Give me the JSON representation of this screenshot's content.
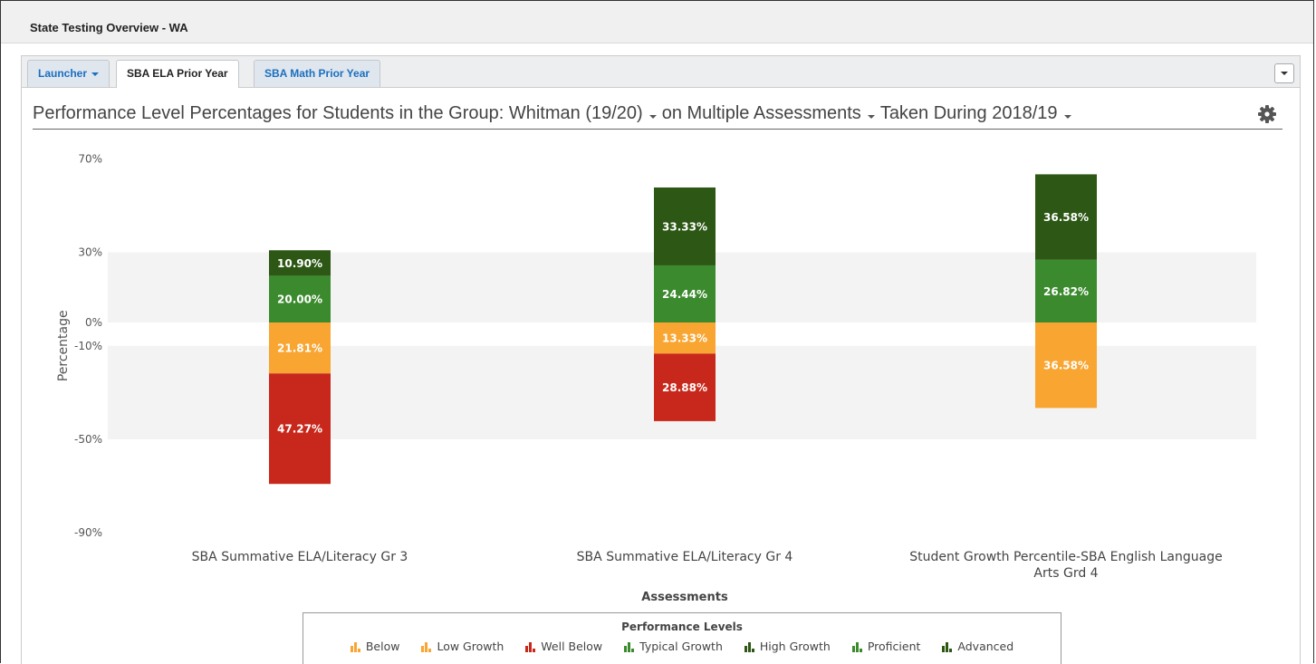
{
  "window": {
    "title": "State Testing Overview - WA"
  },
  "tabs": [
    {
      "label": "Launcher",
      "dropdown": true,
      "active": false
    },
    {
      "label": "SBA ELA Prior Year",
      "active": true
    },
    {
      "label": "SBA Math Prior Year",
      "active": false
    }
  ],
  "headline": {
    "prefix": "Performance Level Percentages for Students in the Group:",
    "group": "Whitman (19/20)",
    "on_word": "on",
    "assessment": "Multiple Assessments",
    "taken_word": "Taken During",
    "year": "2018/19"
  },
  "colors": {
    "advanced": "#2c5714",
    "proficient": "#3c8a2e",
    "below": "#f9a531",
    "well_below": "#c8281c",
    "band": "#f3f3f3"
  },
  "chart_data": {
    "type": "bar",
    "stacked": "diverging",
    "ylabel": "Percentage",
    "xlabel": "Assessments",
    "ylim": [
      -90,
      70
    ],
    "y_ticks": [
      "70%",
      "30%",
      "0%",
      "-10%",
      "-50%",
      "-90%"
    ],
    "categories": [
      "SBA Summative ELA/Literacy Gr 3",
      "SBA Summative ELA/Literacy Gr 4",
      "Student Growth Percentile-SBA English Language Arts Grd 4"
    ],
    "category_lines": [
      [
        "SBA Summative ELA/Literacy Gr 3"
      ],
      [
        "SBA Summative ELA/Literacy Gr 4"
      ],
      [
        "Student Growth Percentile-SBA English Language",
        "Arts Grd 4"
      ]
    ],
    "bars": [
      {
        "segments": [
          {
            "level": "Advanced",
            "value": 10.9,
            "label": "10.90%",
            "color": "#2c5714"
          },
          {
            "level": "Proficient",
            "value": 20.0,
            "label": "20.00%",
            "color": "#3c8a2e"
          },
          {
            "level": "Below",
            "value": -21.81,
            "label": "21.81%",
            "color": "#f9a531"
          },
          {
            "level": "Well Below",
            "value": -47.27,
            "label": "47.27%",
            "color": "#c8281c"
          }
        ]
      },
      {
        "segments": [
          {
            "level": "Advanced",
            "value": 33.33,
            "label": "33.33%",
            "color": "#2c5714"
          },
          {
            "level": "Proficient",
            "value": 24.44,
            "label": "24.44%",
            "color": "#3c8a2e"
          },
          {
            "level": "Below",
            "value": -13.33,
            "label": "13.33%",
            "color": "#f9a531"
          },
          {
            "level": "Well Below",
            "value": -28.88,
            "label": "28.88%",
            "color": "#c8281c"
          }
        ]
      },
      {
        "segments": [
          {
            "level": "High Growth",
            "value": 36.58,
            "label": "36.58%",
            "color": "#2c5714"
          },
          {
            "level": "Typical Growth",
            "value": 26.82,
            "label": "26.82%",
            "color": "#3c8a2e"
          },
          {
            "level": "Low Growth",
            "value": -36.58,
            "label": "36.58%",
            "color": "#f9a531"
          }
        ]
      }
    ],
    "legend": {
      "title": "Performance Levels",
      "items": [
        {
          "label": "Below",
          "color": "#f9a531"
        },
        {
          "label": "Low Growth",
          "color": "#f9a531"
        },
        {
          "label": "Well Below",
          "color": "#c8281c"
        },
        {
          "label": "Typical Growth",
          "color": "#3c8a2e"
        },
        {
          "label": "High Growth",
          "color": "#2c5714"
        },
        {
          "label": "Proficient",
          "color": "#3c8a2e"
        },
        {
          "label": "Advanced",
          "color": "#2c5714"
        }
      ]
    }
  }
}
